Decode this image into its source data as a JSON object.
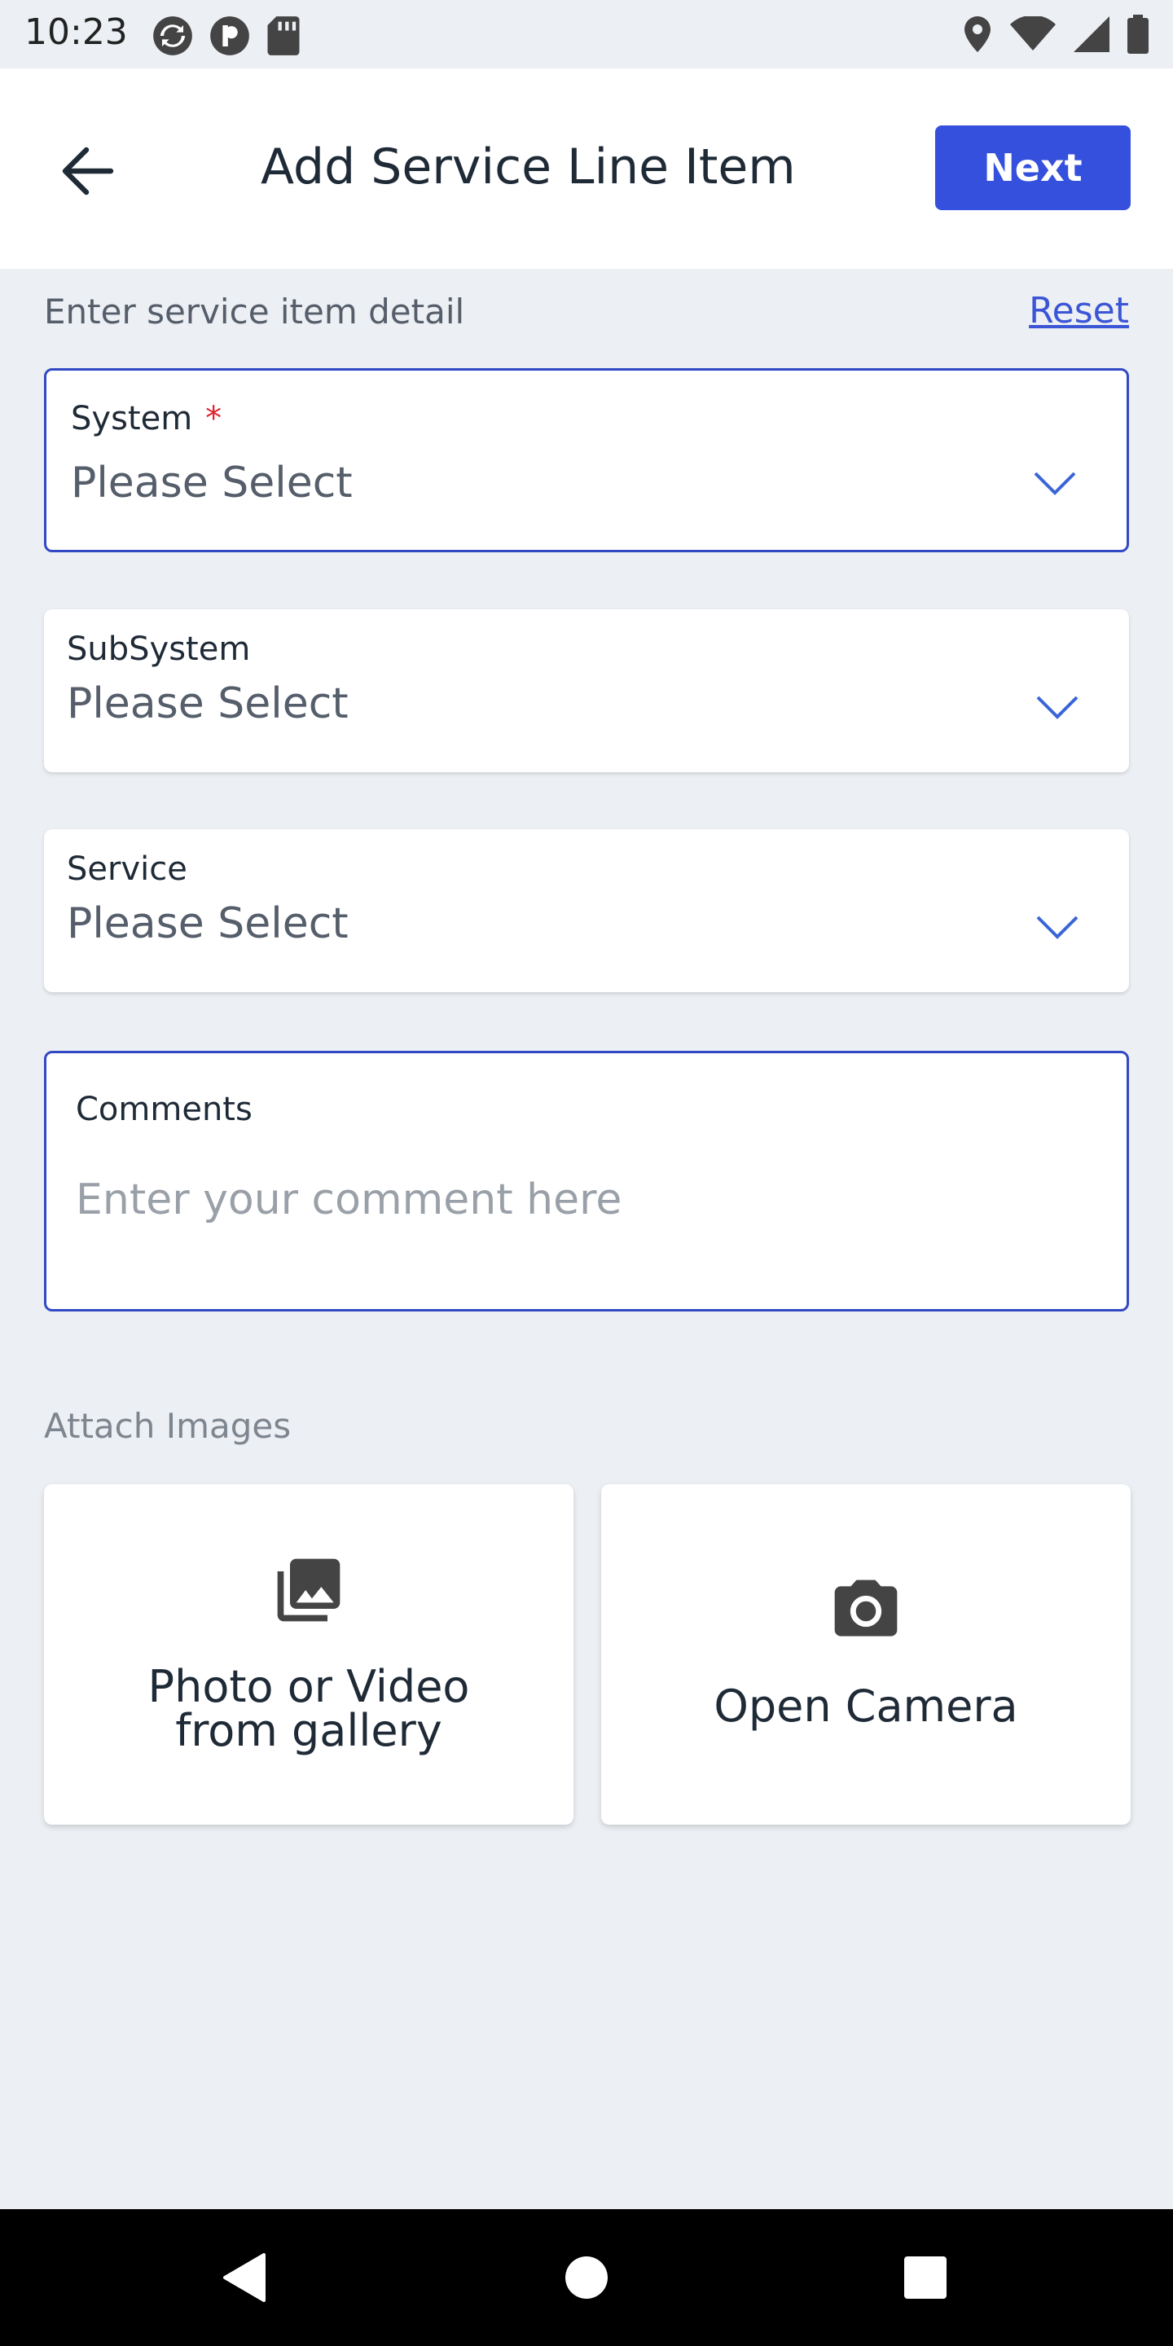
{
  "status_bar": {
    "time": "10:23",
    "left_icons": [
      "sync-icon",
      "pocket-app-icon",
      "sd-card-icon"
    ],
    "right_icons": [
      "location-icon",
      "wifi-icon",
      "signal-icon",
      "battery-icon"
    ]
  },
  "app_bar": {
    "back_icon": "arrow-back-icon",
    "title": "Add Service Line Item",
    "next_label": "Next"
  },
  "form": {
    "subtitle": "Enter service item detail",
    "reset_label": "Reset",
    "system": {
      "label": "System",
      "required_mark": "*",
      "value": "Please Select"
    },
    "subsystem": {
      "label": "SubSystem",
      "value": "Please Select"
    },
    "service": {
      "label": "Service",
      "value": "Please Select"
    },
    "comments": {
      "label": "Comments",
      "placeholder": "Enter your comment here",
      "value": ""
    }
  },
  "attach": {
    "title": "Attach Images",
    "gallery": {
      "icon": "photo-library-icon",
      "line1": "Photo or Video",
      "line2": "from gallery"
    },
    "camera": {
      "icon": "camera-icon",
      "label": "Open Camera"
    }
  },
  "nav_bar": {
    "icons": [
      "back-triangle-icon",
      "home-circle-icon",
      "recents-square-icon"
    ]
  },
  "colors": {
    "accent": "#3450dc",
    "focus_border": "#3149c5",
    "required": "#e0232e",
    "background": "#eceff3"
  }
}
